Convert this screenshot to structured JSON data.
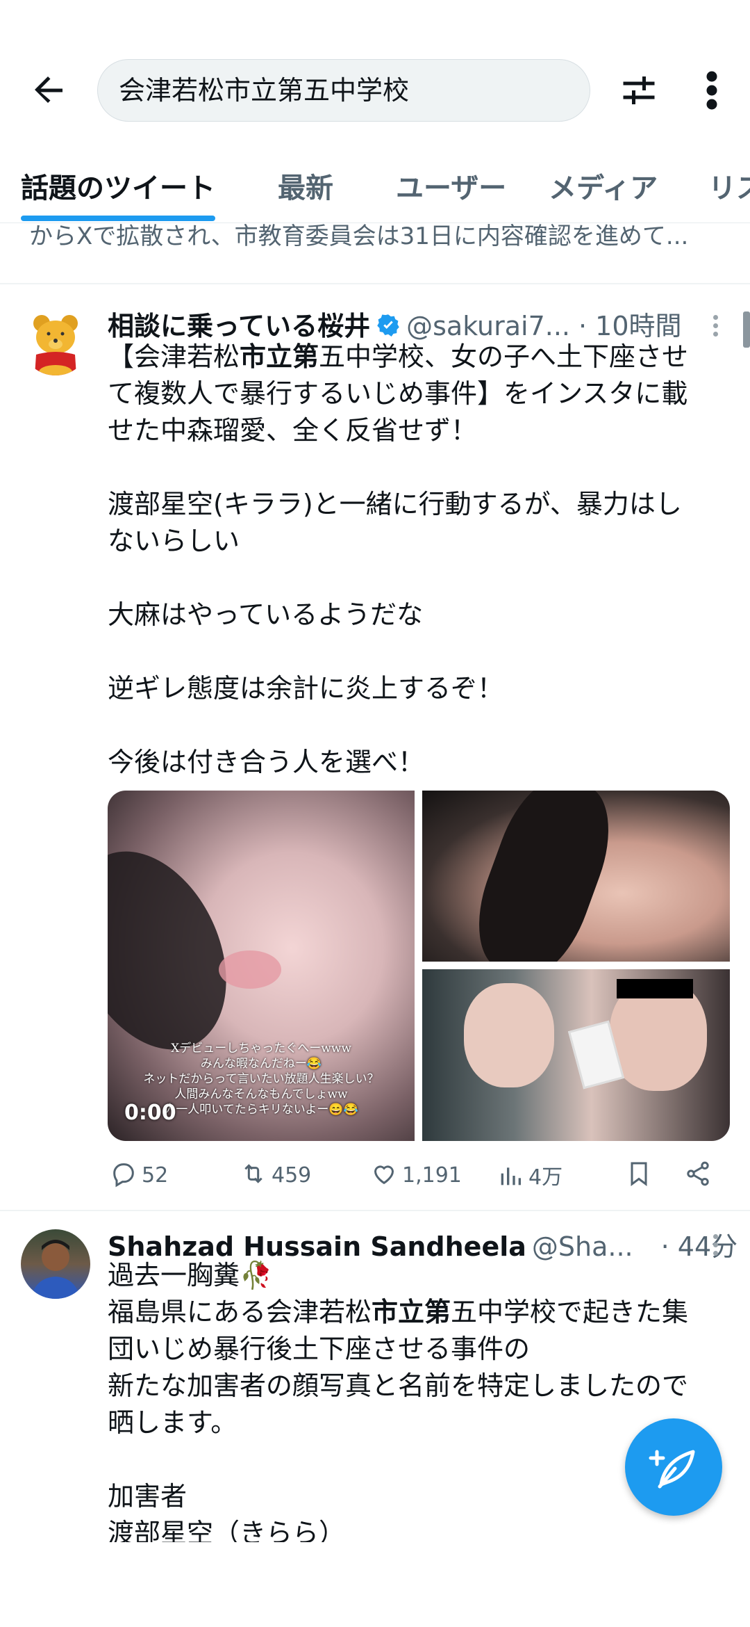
{
  "search": {
    "query": "会津若松市立第五中学校"
  },
  "icons": {
    "back": "arrow-left-icon",
    "filter": "sliders-icon",
    "more": "more-vertical-icon"
  },
  "tabs": [
    {
      "label": "話題のツイート",
      "active": true
    },
    {
      "label": "最新",
      "active": false
    },
    {
      "label": "ユーザー",
      "active": false
    },
    {
      "label": "メディア",
      "active": false
    },
    {
      "label": "リス",
      "active": false
    }
  ],
  "previous_tweet_snippet": "からXで拡散され、市教育委員会は31日に内容確認を進めて...",
  "tweet1": {
    "name": "相談に乗っている桜井",
    "handle": "@sakurai7...",
    "time": "· 10時間",
    "verified": true,
    "text_html_parts": {
      "line1_pre": "【会津若松",
      "line1_bold": "市立第",
      "line1_post": "五中学校、女の子へ土下座させ",
      "line2": "て複数人で暴行するいじめ事件】をインスタに載",
      "line3": "せた中森瑠愛、全く反省せず！",
      "line4": "渡部星空(キララ)と一緒に行動するが、暴力はし",
      "line5": "ないらしい",
      "line6": "大麻はやっているようだな",
      "line7": "逆ギレ態度は余計に炎上するぞ！",
      "line8": "今後は付き合う人を選べ！"
    },
    "video_overlay": {
      "caption1": "Xデビューしちゃったぐへーwww",
      "caption2": "みんな暇なんだねー😂",
      "caption3": "ネットだからって言いたい放題人生楽しい？",
      "caption4": "人間みんなそんなもんでしょww",
      "caption5": "人一人叩いてたらキリないよー😄😂",
      "duration": "0:00"
    },
    "stats": {
      "replies": "52",
      "retweets": "459",
      "likes": "1,191",
      "views": "4万"
    }
  },
  "tweet2": {
    "name": "Shahzad Hussain Sandheela",
    "handle": "@Sha...",
    "time": "· 44分",
    "line1": "過去一胸糞🥀",
    "line2_pre": "福島県にある会津若松",
    "line2_bold": "市立第",
    "line2_post": "五中学校で起きた集",
    "line3": "団いじめ暴行後土下座させる事件の",
    "line4": "新たな加害者の顔写真と名前を特定しましたので",
    "line5": "晒します。",
    "line6": "加害者",
    "line7": "渡部星空（きらら）"
  },
  "colors": {
    "accent": "#1d9bf0",
    "muted": "#536471"
  }
}
